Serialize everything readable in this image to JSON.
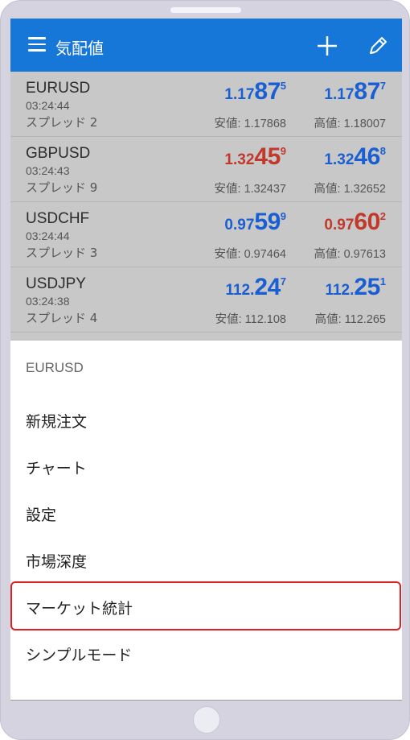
{
  "header": {
    "title": "気配値",
    "add_icon": "plus-icon",
    "edit_icon": "pencil-icon"
  },
  "colors": {
    "appbar": "#1677d8",
    "up": "#1a5fd1",
    "down": "#c0392b",
    "highlight": "#e02020"
  },
  "quotes": [
    {
      "symbol": "EURUSD",
      "time": "03:24:44",
      "spread": "スプレッド 2",
      "bid": {
        "a": "1.17",
        "b": "87",
        "c": "5",
        "color": "blue"
      },
      "ask": {
        "a": "1.17",
        "b": "87",
        "c": "7",
        "color": "blue"
      },
      "low": "安値: 1.17868",
      "high": "高値: 1.18007"
    },
    {
      "symbol": "GBPUSD",
      "time": "03:24:43",
      "spread": "スプレッド 9",
      "bid": {
        "a": "1.32",
        "b": "45",
        "c": "9",
        "color": "red"
      },
      "ask": {
        "a": "1.32",
        "b": "46",
        "c": "8",
        "color": "blue"
      },
      "low": "安値: 1.32437",
      "high": "高値: 1.32652"
    },
    {
      "symbol": "USDCHF",
      "time": "03:24:44",
      "spread": "スプレッド 3",
      "bid": {
        "a": "0.97",
        "b": "59",
        "c": "9",
        "color": "blue"
      },
      "ask": {
        "a": "0.97",
        "b": "60",
        "c": "2",
        "color": "red"
      },
      "low": "安値: 0.97464",
      "high": "高値: 0.97613"
    },
    {
      "symbol": "USDJPY",
      "time": "03:24:38",
      "spread": "スプレッド 4",
      "bid": {
        "a": "112.",
        "b": "24",
        "c": "7",
        "color": "blue"
      },
      "ask": {
        "a": "112.",
        "b": "25",
        "c": "1",
        "color": "blue"
      },
      "low": "安値: 112.108",
      "high": "高値: 112.265"
    }
  ],
  "sheet": {
    "title": "EURUSD",
    "items": [
      "新規注文",
      "チャート",
      "設定",
      "市場深度",
      "マーケット統計",
      "シンプルモード"
    ],
    "highlighted_item": "マーケット統計"
  }
}
